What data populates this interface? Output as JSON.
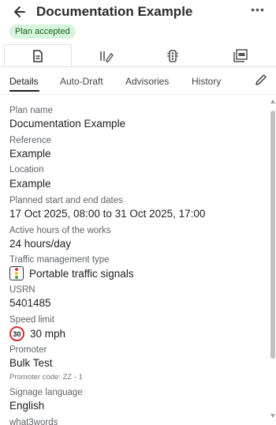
{
  "header": {
    "title": "Documentation Example",
    "back_icon": "arrow-left-icon",
    "more_icon": "more-horizontal-icon",
    "more_label": "•••"
  },
  "status": {
    "label": "Plan accepted",
    "color": "#d6f5dc"
  },
  "icon_tabs": [
    {
      "icon": "document-icon",
      "active": true
    },
    {
      "icon": "edit-columns-icon",
      "active": false
    },
    {
      "icon": "traffic-signal-icon",
      "active": false
    },
    {
      "icon": "pdf-icon",
      "active": false
    }
  ],
  "tabs": {
    "details": "Details",
    "auto_draft": "Auto-Draft",
    "advisories": "Advisories",
    "history": "History",
    "edit_icon": "pencil-icon"
  },
  "details": {
    "plan_name": {
      "label": "Plan name",
      "value": "Documentation Example"
    },
    "reference": {
      "label": "Reference",
      "value": "Example"
    },
    "location": {
      "label": "Location",
      "value": "Example"
    },
    "dates": {
      "label": "Planned start and end dates",
      "value": "17 Oct 2025, 08:00 to 31 Oct 2025, 17:00"
    },
    "hours": {
      "label": "Active hours of the works",
      "value": "24 hours/day"
    },
    "traffic": {
      "label": "Traffic management type",
      "value": "Portable traffic signals",
      "icon": "traffic-light-icon"
    },
    "usrn": {
      "label": "USRN",
      "value": "5401485"
    },
    "speed": {
      "label": "Speed limit",
      "value": "30 mph",
      "sign": "30",
      "icon": "speed-limit-sign-icon"
    },
    "promoter": {
      "label": "Promoter",
      "value": "Bulk Test",
      "sub": "Promoter code: ZZ - 1"
    },
    "signage": {
      "label": "Signage language",
      "value": "English"
    },
    "w3w": {
      "label": "what3words"
    }
  }
}
